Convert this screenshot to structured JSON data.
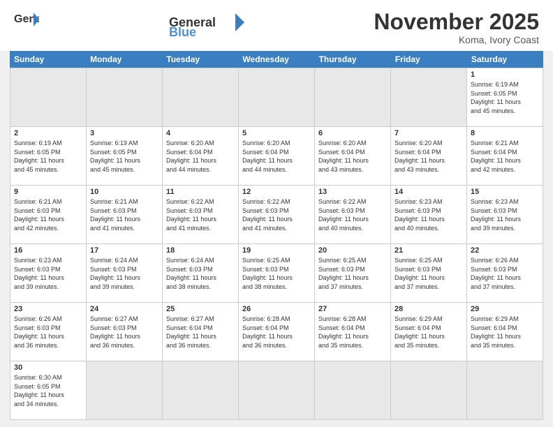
{
  "header": {
    "logo_general": "General",
    "logo_blue": "Blue",
    "month_title": "November 2025",
    "location": "Koma, Ivory Coast"
  },
  "days": [
    "Sunday",
    "Monday",
    "Tuesday",
    "Wednesday",
    "Thursday",
    "Friday",
    "Saturday"
  ],
  "cells": [
    {
      "date": "",
      "info": "",
      "empty": true
    },
    {
      "date": "",
      "info": "",
      "empty": true
    },
    {
      "date": "",
      "info": "",
      "empty": true
    },
    {
      "date": "",
      "info": "",
      "empty": true
    },
    {
      "date": "",
      "info": "",
      "empty": true
    },
    {
      "date": "",
      "info": "",
      "empty": true
    },
    {
      "date": "1",
      "info": "Sunrise: 6:19 AM\nSunset: 6:05 PM\nDaylight: 11 hours\nand 45 minutes.",
      "empty": false
    },
    {
      "date": "2",
      "info": "Sunrise: 6:19 AM\nSunset: 6:05 PM\nDaylight: 11 hours\nand 45 minutes.",
      "empty": false
    },
    {
      "date": "3",
      "info": "Sunrise: 6:19 AM\nSunset: 6:05 PM\nDaylight: 11 hours\nand 45 minutes.",
      "empty": false
    },
    {
      "date": "4",
      "info": "Sunrise: 6:20 AM\nSunset: 6:04 PM\nDaylight: 11 hours\nand 44 minutes.",
      "empty": false
    },
    {
      "date": "5",
      "info": "Sunrise: 6:20 AM\nSunset: 6:04 PM\nDaylight: 11 hours\nand 44 minutes.",
      "empty": false
    },
    {
      "date": "6",
      "info": "Sunrise: 6:20 AM\nSunset: 6:04 PM\nDaylight: 11 hours\nand 43 minutes.",
      "empty": false
    },
    {
      "date": "7",
      "info": "Sunrise: 6:20 AM\nSunset: 6:04 PM\nDaylight: 11 hours\nand 43 minutes.",
      "empty": false
    },
    {
      "date": "8",
      "info": "Sunrise: 6:21 AM\nSunset: 6:04 PM\nDaylight: 11 hours\nand 42 minutes.",
      "empty": false
    },
    {
      "date": "9",
      "info": "Sunrise: 6:21 AM\nSunset: 6:03 PM\nDaylight: 11 hours\nand 42 minutes.",
      "empty": false
    },
    {
      "date": "10",
      "info": "Sunrise: 6:21 AM\nSunset: 6:03 PM\nDaylight: 11 hours\nand 41 minutes.",
      "empty": false
    },
    {
      "date": "11",
      "info": "Sunrise: 6:22 AM\nSunset: 6:03 PM\nDaylight: 11 hours\nand 41 minutes.",
      "empty": false
    },
    {
      "date": "12",
      "info": "Sunrise: 6:22 AM\nSunset: 6:03 PM\nDaylight: 11 hours\nand 41 minutes.",
      "empty": false
    },
    {
      "date": "13",
      "info": "Sunrise: 6:22 AM\nSunset: 6:03 PM\nDaylight: 11 hours\nand 40 minutes.",
      "empty": false
    },
    {
      "date": "14",
      "info": "Sunrise: 6:23 AM\nSunset: 6:03 PM\nDaylight: 11 hours\nand 40 minutes.",
      "empty": false
    },
    {
      "date": "15",
      "info": "Sunrise: 6:23 AM\nSunset: 6:03 PM\nDaylight: 11 hours\nand 39 minutes.",
      "empty": false
    },
    {
      "date": "16",
      "info": "Sunrise: 6:23 AM\nSunset: 6:03 PM\nDaylight: 11 hours\nand 39 minutes.",
      "empty": false
    },
    {
      "date": "17",
      "info": "Sunrise: 6:24 AM\nSunset: 6:03 PM\nDaylight: 11 hours\nand 39 minutes.",
      "empty": false
    },
    {
      "date": "18",
      "info": "Sunrise: 6:24 AM\nSunset: 6:03 PM\nDaylight: 11 hours\nand 38 minutes.",
      "empty": false
    },
    {
      "date": "19",
      "info": "Sunrise: 6:25 AM\nSunset: 6:03 PM\nDaylight: 11 hours\nand 38 minutes.",
      "empty": false
    },
    {
      "date": "20",
      "info": "Sunrise: 6:25 AM\nSunset: 6:03 PM\nDaylight: 11 hours\nand 37 minutes.",
      "empty": false
    },
    {
      "date": "21",
      "info": "Sunrise: 6:25 AM\nSunset: 6:03 PM\nDaylight: 11 hours\nand 37 minutes.",
      "empty": false
    },
    {
      "date": "22",
      "info": "Sunrise: 6:26 AM\nSunset: 6:03 PM\nDaylight: 11 hours\nand 37 minutes.",
      "empty": false
    },
    {
      "date": "23",
      "info": "Sunrise: 6:26 AM\nSunset: 6:03 PM\nDaylight: 11 hours\nand 36 minutes.",
      "empty": false
    },
    {
      "date": "24",
      "info": "Sunrise: 6:27 AM\nSunset: 6:03 PM\nDaylight: 11 hours\nand 36 minutes.",
      "empty": false
    },
    {
      "date": "25",
      "info": "Sunrise: 6:27 AM\nSunset: 6:04 PM\nDaylight: 11 hours\nand 36 minutes.",
      "empty": false
    },
    {
      "date": "26",
      "info": "Sunrise: 6:28 AM\nSunset: 6:04 PM\nDaylight: 11 hours\nand 36 minutes.",
      "empty": false
    },
    {
      "date": "27",
      "info": "Sunrise: 6:28 AM\nSunset: 6:04 PM\nDaylight: 11 hours\nand 35 minutes.",
      "empty": false
    },
    {
      "date": "28",
      "info": "Sunrise: 6:29 AM\nSunset: 6:04 PM\nDaylight: 11 hours\nand 35 minutes.",
      "empty": false
    },
    {
      "date": "29",
      "info": "Sunrise: 6:29 AM\nSunset: 6:04 PM\nDaylight: 11 hours\nand 35 minutes.",
      "empty": false
    },
    {
      "date": "30",
      "info": "Sunrise: 6:30 AM\nSunset: 6:05 PM\nDaylight: 11 hours\nand 34 minutes.",
      "empty": false
    },
    {
      "date": "",
      "info": "",
      "empty": true
    },
    {
      "date": "",
      "info": "",
      "empty": true
    },
    {
      "date": "",
      "info": "",
      "empty": true
    },
    {
      "date": "",
      "info": "",
      "empty": true
    },
    {
      "date": "",
      "info": "",
      "empty": true
    },
    {
      "date": "",
      "info": "",
      "empty": true
    }
  ]
}
